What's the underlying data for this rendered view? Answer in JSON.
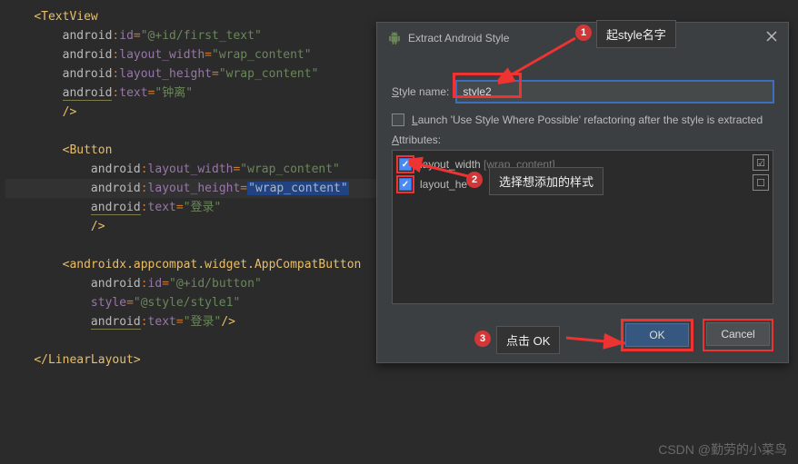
{
  "editor": {
    "lines": [
      {
        "indent": 1,
        "type": "open",
        "tag": "TextView"
      },
      {
        "indent": 2,
        "type": "attr",
        "ns": "android",
        "name": "id",
        "val": "@+id/first_text"
      },
      {
        "indent": 2,
        "type": "attr",
        "ns": "android",
        "name": "layout_width",
        "val": "wrap_content"
      },
      {
        "indent": 2,
        "type": "attr",
        "ns": "android",
        "name": "layout_height",
        "val": "wrap_content"
      },
      {
        "indent": 2,
        "type": "attr",
        "ns": "android",
        "name": "text",
        "val": "钟离",
        "warn": true
      },
      {
        "indent": 2,
        "type": "close_self"
      },
      {
        "indent": 0,
        "type": "blank"
      },
      {
        "indent": 2,
        "type": "open",
        "tag": "Button"
      },
      {
        "indent": 3,
        "type": "attr",
        "ns": "android",
        "name": "layout_width",
        "val": "wrap_content"
      },
      {
        "indent": 3,
        "type": "attr",
        "ns": "android",
        "name": "layout_height",
        "val": "wrap_content",
        "selected": true,
        "hl": true
      },
      {
        "indent": 3,
        "type": "attr",
        "ns": "android",
        "name": "text",
        "val": "登录",
        "warn": true
      },
      {
        "indent": 3,
        "type": "close_self"
      },
      {
        "indent": 0,
        "type": "blank"
      },
      {
        "indent": 2,
        "type": "open",
        "tag": "androidx.appcompat.widget.AppCompatButton"
      },
      {
        "indent": 3,
        "type": "attr",
        "ns": "android",
        "name": "id",
        "val": "@+id/button"
      },
      {
        "indent": 3,
        "type": "style",
        "name": "style",
        "val": "@style/style1"
      },
      {
        "indent": 3,
        "type": "attr_close",
        "ns": "android",
        "name": "text",
        "val": "登录",
        "warn": true
      },
      {
        "indent": 0,
        "type": "blank"
      },
      {
        "indent": 1,
        "type": "close",
        "tag": "LinearLayout"
      }
    ]
  },
  "dialog": {
    "title": "Extract Android Style",
    "style_name_label": "Style name:",
    "style_name_value": "style2",
    "launch_label": "Launch 'Use Style Where Possible' refactoring after the style is extracted",
    "attrs_label": "Attributes:",
    "attrs": [
      {
        "name": "layout_width",
        "val": "[wrap_content]"
      },
      {
        "name": "layout_height",
        "val": ""
      }
    ],
    "ok": "OK",
    "cancel": "Cancel"
  },
  "annotations": {
    "name_tip": "起style名字",
    "select_tip": "选择想添加的样式",
    "ok_tip": "点击 OK",
    "badge1": "1",
    "badge2": "2",
    "badge3": "3"
  },
  "watermark": "CSDN @勤劳的小菜鸟"
}
